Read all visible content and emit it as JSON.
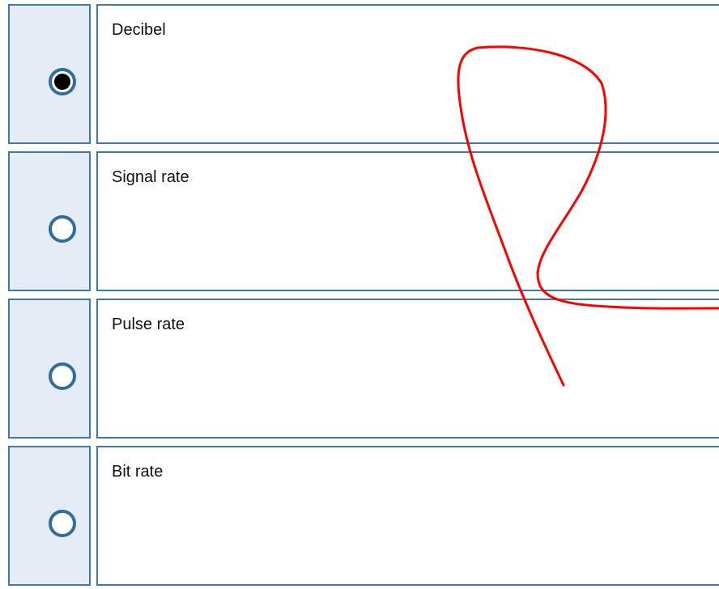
{
  "options": [
    {
      "label": "Decibel",
      "selected": true
    },
    {
      "label": "Signal rate",
      "selected": false
    },
    {
      "label": "Pulse rate",
      "selected": false
    },
    {
      "label": "Bit rate",
      "selected": false
    }
  ],
  "annotation": {
    "color": "#ff0000"
  },
  "colors": {
    "border": "#3d7aab",
    "selector_bg": "#e6ecf6",
    "radio": "#2e6d9e"
  }
}
